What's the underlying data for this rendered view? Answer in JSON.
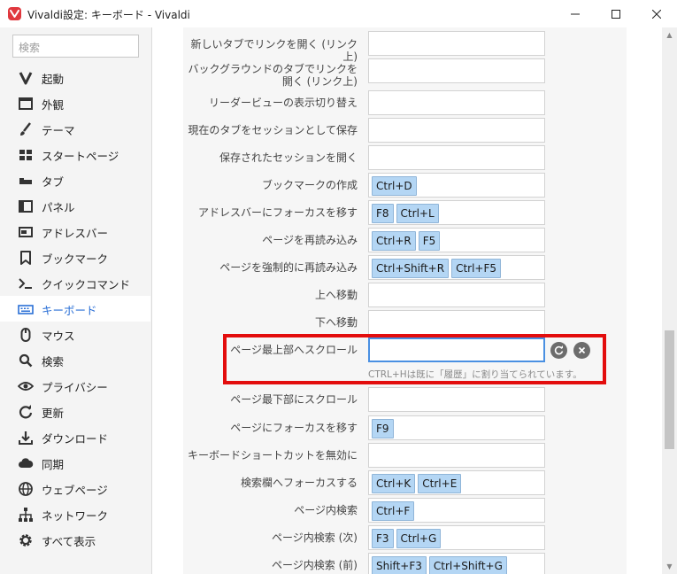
{
  "window": {
    "title": "Vivaldi設定: キーボード - Vivaldi",
    "logo_letter": "V",
    "controls": [
      "minimize",
      "maximize",
      "close"
    ]
  },
  "sidebar": {
    "search_placeholder": "検索",
    "items": [
      {
        "label": "起動",
        "icon": "vivaldi-v-icon"
      },
      {
        "label": "外観",
        "icon": "window-icon"
      },
      {
        "label": "テーマ",
        "icon": "brush-icon"
      },
      {
        "label": "スタートページ",
        "icon": "grid-icon"
      },
      {
        "label": "タブ",
        "icon": "tabs-icon"
      },
      {
        "label": "パネル",
        "icon": "panel-icon"
      },
      {
        "label": "アドレスバー",
        "icon": "addressbar-icon"
      },
      {
        "label": "ブックマーク",
        "icon": "bookmark-icon"
      },
      {
        "label": "クイックコマンド",
        "icon": "quick-command-icon"
      },
      {
        "label": "キーボード",
        "icon": "keyboard-icon",
        "active": true
      },
      {
        "label": "マウス",
        "icon": "mouse-icon"
      },
      {
        "label": "検索",
        "icon": "search-icon"
      },
      {
        "label": "プライバシー",
        "icon": "eye-icon"
      },
      {
        "label": "更新",
        "icon": "refresh-icon"
      },
      {
        "label": "ダウンロード",
        "icon": "download-icon"
      },
      {
        "label": "同期",
        "icon": "cloud-icon"
      },
      {
        "label": "ウェブページ",
        "icon": "globe-icon"
      },
      {
        "label": "ネットワーク",
        "icon": "network-icon"
      },
      {
        "label": "すべて表示",
        "icon": "gear-icon"
      }
    ]
  },
  "shortcuts": [
    {
      "label": "新しいタブでリンクを開く (リンク上)",
      "keys": []
    },
    {
      "label": "バックグラウンドのタブでリンクを開く (リンク上)",
      "keys": []
    },
    {
      "label": "リーダービューの表示切り替え",
      "keys": []
    },
    {
      "label": "現在のタブをセッションとして保存",
      "keys": []
    },
    {
      "label": "保存されたセッションを開く",
      "keys": []
    },
    {
      "label": "ブックマークの作成",
      "keys": [
        "Ctrl+D"
      ]
    },
    {
      "label": "アドレスバーにフォーカスを移す",
      "keys": [
        "F8",
        "Ctrl+L"
      ]
    },
    {
      "label": "ページを再読み込み",
      "keys": [
        "Ctrl+R",
        "F5"
      ]
    },
    {
      "label": "ページを強制的に再読み込み",
      "keys": [
        "Ctrl+Shift+R",
        "Ctrl+F5"
      ]
    },
    {
      "label": "上へ移動",
      "keys": []
    },
    {
      "label": "下へ移動",
      "keys": []
    },
    {
      "label": "ページ最上部へスクロール",
      "keys": [],
      "editing": true,
      "warning": "CTRL+Hは既に「履歴」に割り当てられています。"
    },
    {
      "label": "ページ最下部にスクロール",
      "keys": []
    },
    {
      "label": "ページにフォーカスを移す",
      "keys": [
        "F9"
      ]
    },
    {
      "label": "キーボードショートカットを無効に",
      "keys": []
    },
    {
      "label": "検索欄へフォーカスする",
      "keys": [
        "Ctrl+K",
        "Ctrl+E"
      ]
    },
    {
      "label": "ページ内検索",
      "keys": [
        "Ctrl+F"
      ]
    },
    {
      "label": "ページ内検索 (次)",
      "keys": [
        "F3",
        "Ctrl+G"
      ]
    },
    {
      "label": "ページ内検索 (前)",
      "keys": [
        "Shift+F3",
        "Ctrl+Shift+G"
      ]
    }
  ],
  "colors": {
    "accent": "#2a6fd6",
    "chip": "#b4d6f4",
    "highlight": "#e30d0d",
    "logo": "#e0383e"
  }
}
